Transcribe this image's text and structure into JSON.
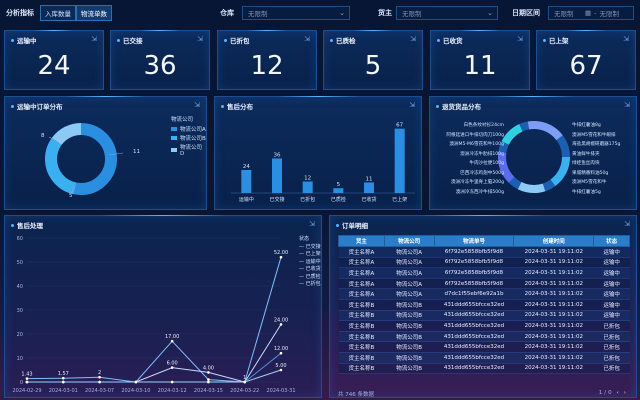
{
  "filters": {
    "metric_label": "分析指标",
    "metric_buttons": [
      "入库数量",
      "物流单数"
    ],
    "warehouse_label": "仓库",
    "warehouse_value": "无限制",
    "owner_label": "货主",
    "owner_value": "无限制",
    "date_label": "日期区间",
    "date_start": "无限制",
    "date_sep": "-",
    "date_end": "无限制"
  },
  "kpis": [
    {
      "label": "运输中",
      "value": "24"
    },
    {
      "label": "已交接",
      "value": "36"
    },
    {
      "label": "已折包",
      "value": "12"
    },
    {
      "label": "已质检",
      "value": "5"
    },
    {
      "label": "已收货",
      "value": "11"
    },
    {
      "label": "已上架",
      "value": "67"
    }
  ],
  "colors": {
    "accent": "#5ab1ff",
    "bar": "#2a8fe0",
    "pie1": "#2a8fe0",
    "pie2": "#3ab0f0",
    "pie3": "#8ccaf5",
    "line": "#7ec0ff"
  },
  "transit_pie": {
    "title": "运输中订单分布",
    "legend_title": "物流公司",
    "legend": [
      "物流公司A",
      "物流公司B",
      "物流公司D"
    ],
    "labels": [
      "8",
      "11",
      "5"
    ]
  },
  "aftersales_bar": {
    "title": "售后分布",
    "chart_data": {
      "type": "bar",
      "categories": [
        "运输中",
        "已交接",
        "已折包",
        "已质检",
        "已收货",
        "已上架"
      ],
      "values": [
        24,
        36,
        12,
        5,
        11,
        67
      ],
      "ylim": [
        0,
        75
      ]
    }
  },
  "goods_pie": {
    "title": "退货货品分布",
    "left_labels": [
      "白色条纹衬衫24cm",
      "阿根廷进口牛排切肉刀100g",
      "澳洲M5-M6雪花和牛100g",
      "澳洲冷冻牛肋排100g",
      "牛肉沙拉便100g",
      "巴西冷冻鸡翅中500g",
      "澳洲冷冻牛里脊上脑200g",
      "澳洲冷冻西冷牛排500g"
    ],
    "right_labels": [
      "牛排红薯油8g",
      "澳洲M5雪花和牛眼排",
      "海盐黑胡椒研磨器175g",
      "黄油鲜牛排夹",
      "绿娃鱼丝肉块",
      "果城精番料油50g",
      "澳洲M5雪花和牛",
      "牛排红薯油5g"
    ]
  },
  "aftersales_line": {
    "title": "售后处理",
    "chart_data": {
      "type": "line",
      "x": [
        "2024-02-29",
        "2024-03-01",
        "2024-03-07",
        "2024-03-10",
        "2024-03-12",
        "2024-03-15",
        "2024-03-22",
        "2024-03-31"
      ],
      "yticks": [
        0,
        10,
        20,
        30,
        40,
        50,
        60
      ],
      "ylim": [
        0,
        60
      ],
      "series": [
        {
          "name": "已交接",
          "values": [
            1.43,
            1.57,
            2,
            0,
            17,
            1,
            0,
            52
          ]
        },
        {
          "name": "已上架",
          "values": [
            0,
            0,
            0,
            0,
            6,
            4,
            0,
            24
          ]
        },
        {
          "name": "运输中",
          "values": [
            0,
            0,
            0,
            0,
            0,
            0,
            0,
            12
          ]
        },
        {
          "name": "已收货",
          "values": [
            0,
            0,
            0,
            0,
            0,
            0,
            0,
            5
          ]
        }
      ],
      "point_labels": [
        {
          "label": "1.43",
          "x": 0,
          "y": 1.43
        },
        {
          "label": "1.57",
          "x": 1,
          "y": 1.57
        },
        {
          "label": "2",
          "x": 2,
          "y": 2
        },
        {
          "label": "17.00",
          "x": 4,
          "y": 17
        },
        {
          "label": "6.00",
          "x": 4,
          "y": 6
        },
        {
          "label": "4.00",
          "x": 5,
          "y": 4
        },
        {
          "label": "1",
          "x": 6,
          "y": 0
        },
        {
          "label": "52.00",
          "x": 7,
          "y": 52
        },
        {
          "label": "24.00",
          "x": 7,
          "y": 24
        },
        {
          "label": "12.00",
          "x": 7,
          "y": 12
        },
        {
          "label": "5.00",
          "x": 7,
          "y": 5
        }
      ]
    },
    "legend_title": "状态",
    "legend": [
      "已交接",
      "已上架",
      "运输中",
      "已收货",
      "已质检",
      "已折包"
    ]
  },
  "orders": {
    "title": "订单明细",
    "columns": [
      "货主",
      "物流公司",
      "物流单号",
      "创建时间",
      "状态"
    ],
    "rows": [
      [
        "货主名称A",
        "物流公司A",
        "6f792e5858bfb5f9d8",
        "2024-03-31 19:11:02",
        "运输中"
      ],
      [
        "货主名称A",
        "物流公司A",
        "6f792e5858bfb5f9d8",
        "2024-03-31 19:11:02",
        "运输中"
      ],
      [
        "货主名称A",
        "物流公司A",
        "6f792e5858bfb5f9d8",
        "2024-03-31 19:11:02",
        "运输中"
      ],
      [
        "货主名称A",
        "物流公司A",
        "6f792e5858bfb5f9d8",
        "2024-03-31 19:11:02",
        "运输中"
      ],
      [
        "货主名称A",
        "物流公司A",
        "d7dc1f55ebf6e92a1b",
        "2024-03-31 19:11:02",
        "运输中"
      ],
      [
        "货主名称B",
        "物流公司B",
        "431ddd655bfcce32ed",
        "2024-03-31 19:11:02",
        "运输中"
      ],
      [
        "货主名称B",
        "物流公司B",
        "431ddd655bfcce32ed",
        "2024-03-31 19:11:02",
        "运输中"
      ],
      [
        "货主名称B",
        "物流公司B",
        "431ddd655bfcce32ed",
        "2024-03-31 19:11:02",
        "已折包"
      ],
      [
        "货主名称B",
        "物流公司B",
        "431ddd655bfcce32ed",
        "2024-03-31 19:11:02",
        "已折包"
      ],
      [
        "货主名称B",
        "物流公司B",
        "431ddd655bfcce32ed",
        "2024-03-31 19:11:02",
        "已折包"
      ],
      [
        "货主名称B",
        "物流公司B",
        "431ddd655bfcce32ed",
        "2024-03-31 19:11:02",
        "已折包"
      ],
      [
        "货主名称B",
        "物流公司B",
        "431ddd655bfcce32ed",
        "2024-03-31 19:11:02",
        "已折包"
      ]
    ],
    "footer_total": "共 746 条数据",
    "page_current": "1",
    "page_sep": "/",
    "page_total": "0"
  }
}
